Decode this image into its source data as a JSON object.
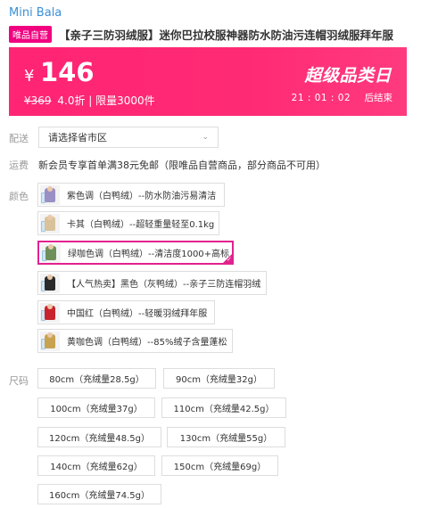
{
  "brand": "Mini Bala",
  "product": {
    "tag": "唯品自营",
    "title": "【亲子三防羽绒服】迷你巴拉校服神器防水防油污连帽羽绒服拜年服"
  },
  "price_bar": {
    "currency": "¥",
    "price": "146",
    "original_price": "¥369",
    "discount_and_limit": "4.0折 | 限量3000件",
    "promo_title": "超级品类日",
    "countdown": "21 : 01 : 02",
    "countdown_suffix": "后结束",
    "colors": {
      "bar": "#ff2a74",
      "tag": "#f10180",
      "accent_border": "#e2228e"
    }
  },
  "delivery": {
    "label": "配送",
    "select_value": "请选择省市区",
    "chevron": "chevron-down-icon"
  },
  "shipping": {
    "label": "运费",
    "text": "新会员专享首单满38元免邮（限唯品自营商品，部分商品不可用）"
  },
  "colors": {
    "label": "颜色",
    "selected_index": 2,
    "options": [
      {
        "label": "紫色调（白鸭绒）--防水防油污易清洁",
        "swatch": "#9b8fc4"
      },
      {
        "label": "卡其（白鸭绒）--超轻重量轻至0.1kg",
        "swatch": "#d9c29a"
      },
      {
        "label": "绿咖色调（白鸭绒）--清洁度1000+高标",
        "swatch": "#6f8f5a"
      },
      {
        "label": "【人气热卖】黑色（灰鸭绒）--亲子三防连帽羽绒",
        "swatch": "#2b2b2b"
      },
      {
        "label": "中国红（白鸭绒）--轻暖羽绒拜年服",
        "swatch": "#c8232c"
      },
      {
        "label": "黄咖色调（白鸭绒）--85%绒子含量蓬松",
        "swatch": "#c9a24f"
      }
    ]
  },
  "sizes": {
    "label": "尺码",
    "options": [
      "80cm（充绒量28.5g）",
      "90cm（充绒量32g）",
      "100cm（充绒量37g）",
      "110cm（充绒量42.5g）",
      "120cm（充绒量48.5g）",
      "130cm（充绒量55g）",
      "140cm（充绒量62g）",
      "150cm（充绒量69g）",
      "160cm（充绒量74.5g）"
    ]
  }
}
